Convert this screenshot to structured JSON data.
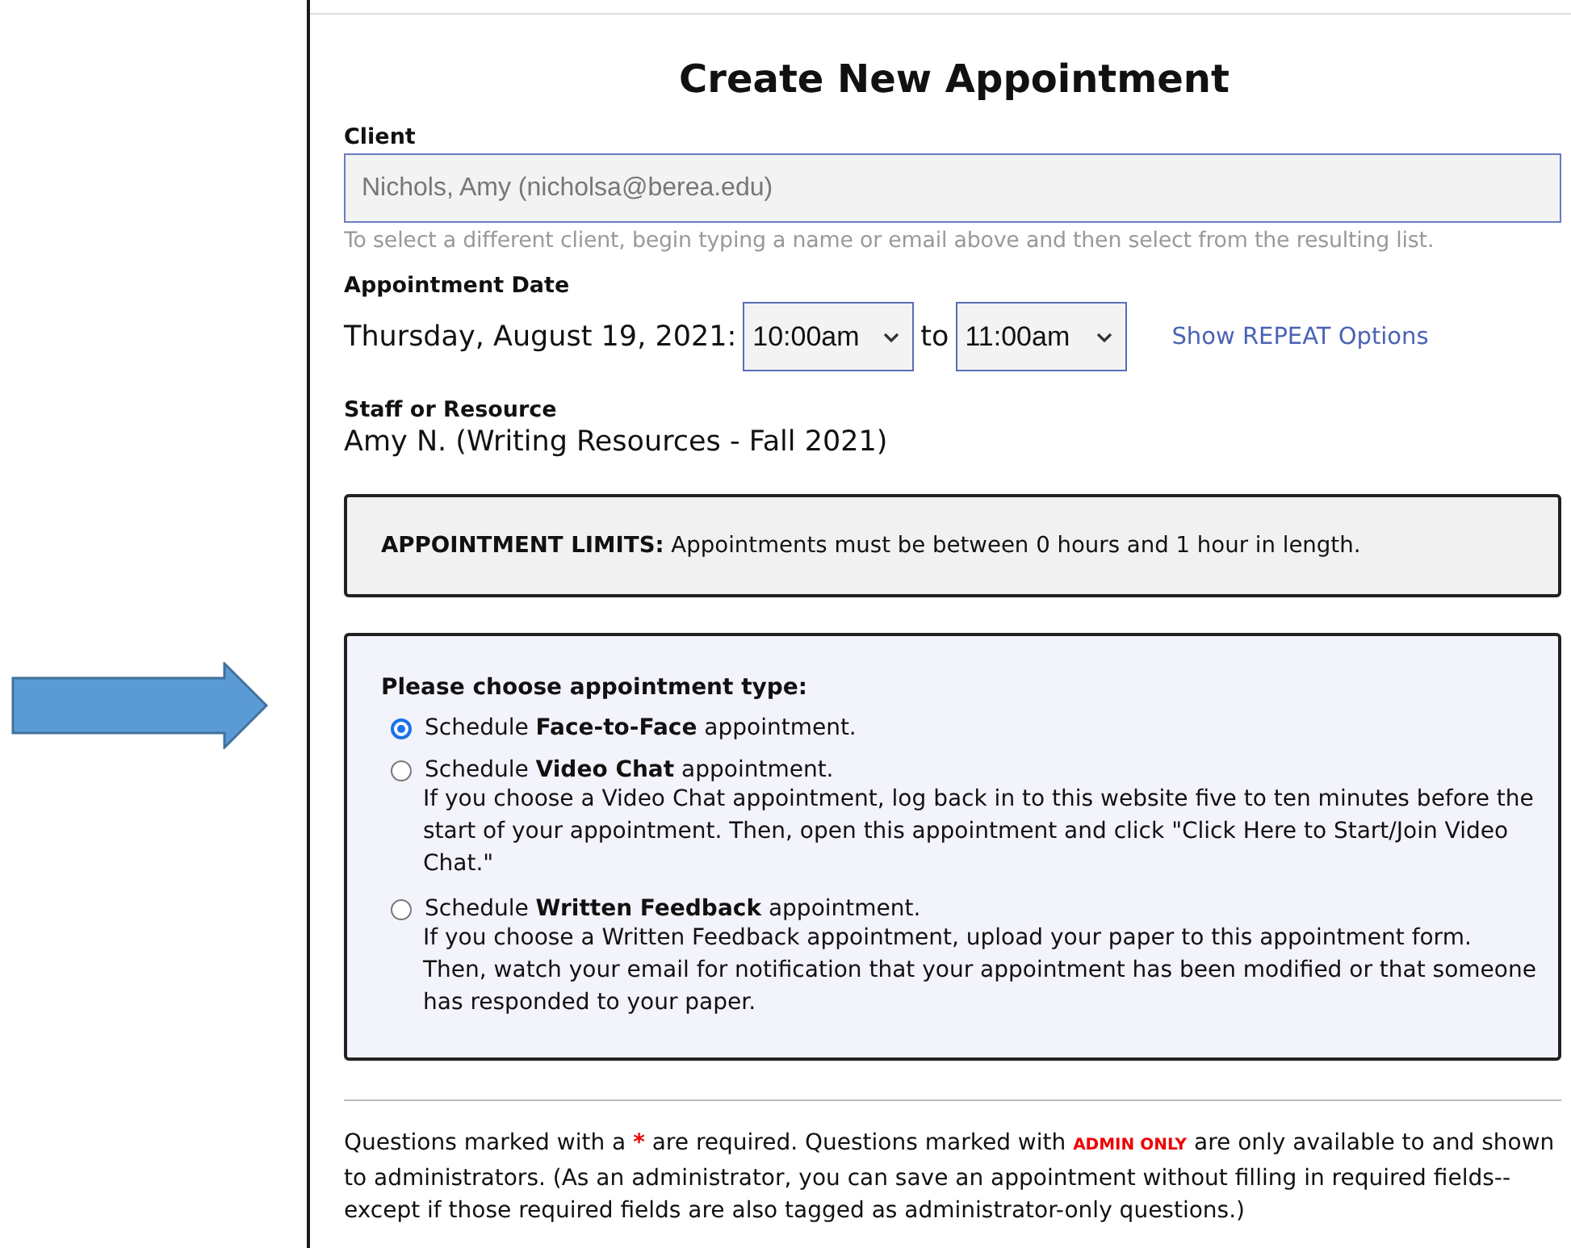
{
  "title": "Create New Appointment",
  "client": {
    "label": "Client",
    "value": "Nichols, Amy (nicholsa@berea.edu)",
    "hint": "To select a different client, begin typing a name or email above and then select from the resulting list."
  },
  "date": {
    "label": "Appointment Date",
    "text": "Thursday, August 19, 2021:",
    "start": "10:00am",
    "separator": "to",
    "end": "11:00am",
    "repeat_link": "Show REPEAT Options"
  },
  "staff": {
    "label": "Staff or Resource",
    "value": "Amy N. (Writing Resources - Fall 2021)"
  },
  "limits": {
    "text": "**APPOINTMENT LIMITS:** Appointments must be between 0 hours and 1 hour in length."
  },
  "type_box": {
    "heading": "Please choose appointment type:",
    "options": [
      {
        "label": "Schedule **Face-to-Face** appointment.",
        "selected": true
      },
      {
        "label": "Schedule **Video Chat** appointment.",
        "selected": false,
        "description": "If you choose a Video Chat appointment, log back in to this website five to ten minutes before the start of your appointment. Then, open this appointment and click \"Click Here to Start/Join Video Chat.\""
      },
      {
        "label": "Schedule **Written Feedback** appointment.",
        "selected": false,
        "description": "If you choose a Written Feedback appointment, upload your paper to this appointment form. Then, watch your email for notification that your appointment has been modified or that someone has responded to your paper."
      }
    ]
  },
  "notice": [
    {
      "kind": "text",
      "text": "Questions marked with a "
    },
    {
      "kind": "required_mark",
      "text": "*"
    },
    {
      "kind": "text",
      "text": " are required. Questions marked with "
    },
    {
      "kind": "admin_tag",
      "text": "ADMIN ONLY"
    },
    {
      "kind": "text",
      "text": " are only available to and shown to administrators. (As an administrator, you can save an appointment without filling in required fields--except if those required fields are also tagged as administrator-only questions.)"
    }
  ]
}
